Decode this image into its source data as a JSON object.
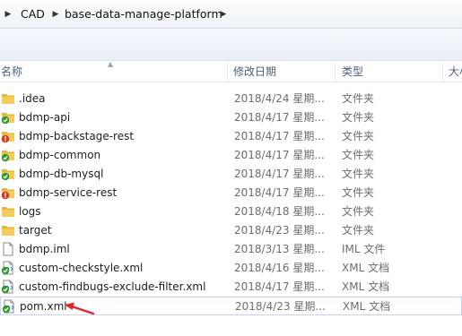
{
  "breadcrumb": {
    "items": [
      "CAD",
      "base-data-manage-platform"
    ]
  },
  "columns": {
    "name": "名称",
    "date": "修改日期",
    "type": "类型",
    "size": "大小"
  },
  "files": [
    {
      "name": ".idea",
      "date": "2018/4/24 星期...",
      "type": "文件夹",
      "icon": "folder-icon"
    },
    {
      "name": "bdmp-api",
      "date": "2018/4/17 星期...",
      "type": "文件夹",
      "icon": "folder-synced-icon"
    },
    {
      "name": "bdmp-backstage-rest",
      "date": "2018/4/17 星期...",
      "type": "文件夹",
      "icon": "folder-conflict-icon"
    },
    {
      "name": "bdmp-common",
      "date": "2018/4/17 星期...",
      "type": "文件夹",
      "icon": "folder-synced-icon"
    },
    {
      "name": "bdmp-db-mysql",
      "date": "2018/4/17 星期...",
      "type": "文件夹",
      "icon": "folder-synced-icon"
    },
    {
      "name": "bdmp-service-rest",
      "date": "2018/4/17 星期...",
      "type": "文件夹",
      "icon": "folder-conflict-icon"
    },
    {
      "name": "logs",
      "date": "2018/4/18 星期...",
      "type": "文件夹",
      "icon": "folder-icon"
    },
    {
      "name": "target",
      "date": "2018/4/23 星期...",
      "type": "文件夹",
      "icon": "folder-icon"
    },
    {
      "name": "bdmp.iml",
      "date": "2018/3/13 星期...",
      "type": "IML 文件",
      "icon": "file-icon"
    },
    {
      "name": "custom-checkstyle.xml",
      "date": "2018/4/16 星期...",
      "type": "XML 文档",
      "icon": "xml-synced-icon"
    },
    {
      "name": "custom-findbugs-exclude-filter.xml",
      "date": "2018/4/17 星期...",
      "type": "XML 文档",
      "icon": "xml-synced-icon"
    },
    {
      "name": "pom.xml",
      "date": "2018/4/23 星期...",
      "type": "XML 文档",
      "icon": "xml-synced-icon"
    }
  ],
  "colors": {
    "folder": "#e8b43a",
    "synced_badge": "#2e9a2e",
    "conflict_badge": "#d43a24",
    "arrow": "#e0262b",
    "header_text": "#4c607a"
  }
}
